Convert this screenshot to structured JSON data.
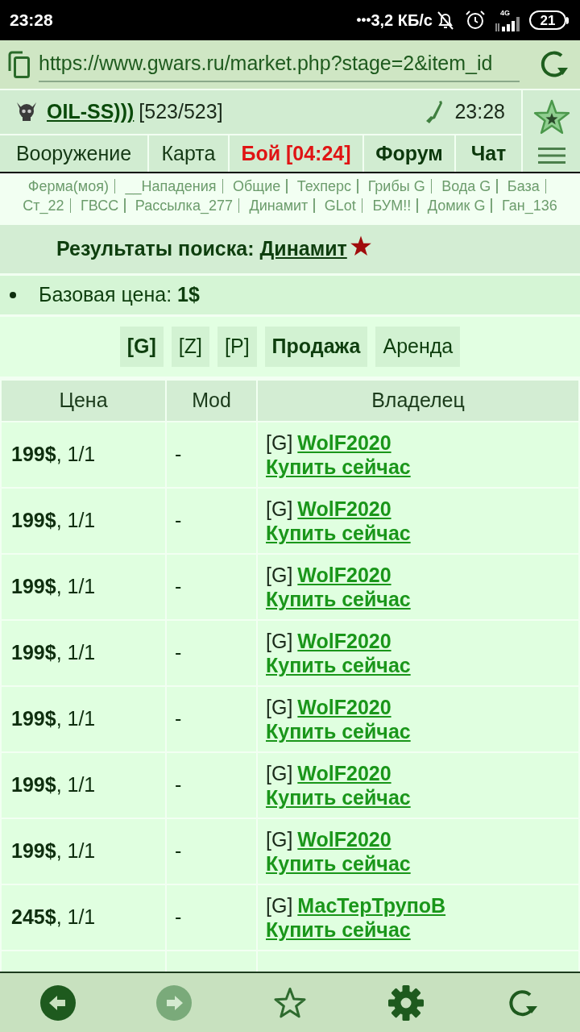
{
  "status_bar": {
    "time": "23:28",
    "notification_dots": "•••",
    "network_speed": "3,2 КБ/с",
    "network_type": "4G",
    "battery": "21"
  },
  "address_bar": {
    "url": "https://www.gwars.ru/market.php?stage=2&item_id"
  },
  "header": {
    "player_name": "OIL-SS)))",
    "hp": "[523/523]",
    "time": "23:28"
  },
  "nav_tabs": [
    {
      "label": "Вооружение",
      "kind": "plain"
    },
    {
      "label": "Карта",
      "kind": "plain"
    },
    {
      "label": "Бой [04:24]",
      "kind": "alert"
    },
    {
      "label": "Форум",
      "kind": "bold"
    },
    {
      "label": "Чат",
      "kind": "bold"
    }
  ],
  "quick_links": [
    "Ферма(моя)",
    "__Нападения",
    "Общие",
    "Техперс",
    "Грибы G",
    "Вода G",
    "База",
    "Ст_22",
    "ГВСС",
    "Рассылка_277",
    "Динамит",
    "GLot",
    "БУМ!!",
    "Домик G",
    "Ган_136"
  ],
  "search_results": {
    "label": "Результаты поиска:",
    "item": "Динамит"
  },
  "base_price": "Базовая цена: **1$**",
  "filters": {
    "servers": [
      {
        "label": "[G]",
        "selected": true
      },
      {
        "label": "[Z]",
        "selected": false
      },
      {
        "label": "[P]",
        "selected": false
      }
    ],
    "modes": [
      {
        "label": "Продажа",
        "selected": true
      },
      {
        "label": "Аренда",
        "selected": false
      }
    ]
  },
  "table": {
    "columns": [
      "Цена",
      "Mod",
      "Владелец"
    ],
    "rows": [
      {
        "price": "**199$**, 1/1",
        "mod": "-",
        "clan": "[G]",
        "owner": "WolF2020",
        "action": "Купить сейчас"
      },
      {
        "price": "**199$**, 1/1",
        "mod": "-",
        "clan": "[G]",
        "owner": "WolF2020",
        "action": "Купить сейчас"
      },
      {
        "price": "**199$**, 1/1",
        "mod": "-",
        "clan": "[G]",
        "owner": "WolF2020",
        "action": "Купить сейчас"
      },
      {
        "price": "**199$**, 1/1",
        "mod": "-",
        "clan": "[G]",
        "owner": "WolF2020",
        "action": "Купить сейчас"
      },
      {
        "price": "**199$**, 1/1",
        "mod": "-",
        "clan": "[G]",
        "owner": "WolF2020",
        "action": "Купить сейчас"
      },
      {
        "price": "**199$**, 1/1",
        "mod": "-",
        "clan": "[G]",
        "owner": "WolF2020",
        "action": "Купить сейчас"
      },
      {
        "price": "**199$**, 1/1",
        "mod": "-",
        "clan": "[G]",
        "owner": "WolF2020",
        "action": "Купить сейчас"
      },
      {
        "price": "**245$**, 1/1",
        "mod": "-",
        "clan": "[G]",
        "owner": "МасТерТрупоВ",
        "action": "Купить сейчас"
      }
    ]
  },
  "browser_toolbar": {
    "back": {
      "disabled": false
    },
    "forward": {
      "disabled": true
    }
  }
}
